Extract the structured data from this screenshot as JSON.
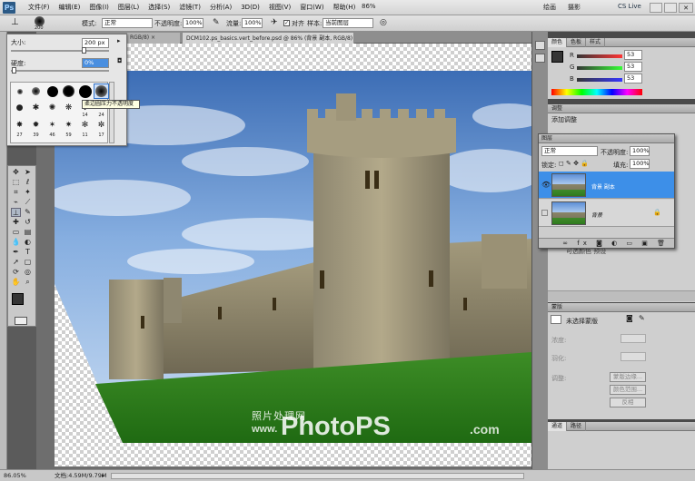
{
  "menubar": {
    "logo": "Ps",
    "items": [
      "文件(F)",
      "编辑(E)",
      "图像(I)",
      "图层(L)",
      "选择(S)",
      "滤镜(T)",
      "分析(A)",
      "3D(D)",
      "视图(V)",
      "窗口(W)",
      "帮助(H)"
    ],
    "zoom": "86%",
    "workspace": [
      "绘画",
      "摄影"
    ],
    "cslive": "CS Live"
  },
  "optionsbar": {
    "size": "200",
    "mode_label": "模式:",
    "mode_value": "正常",
    "opacity_label": "不透明度:",
    "opacity_value": "100%",
    "flow_label": "流量:",
    "flow_value": "100%",
    "align_label": "对齐",
    "sample_label": "样本:",
    "sample_value": "当前图层"
  },
  "tabs": {
    "tab1": "RGB/8) ×",
    "tab2": "DCM102.ps_basics.vert_before.psd @ 86% (背景 副本, RGB/8) *"
  },
  "brushpanel": {
    "size_label": "大小:",
    "size_value": "200 px",
    "hardness_label": "硬度:",
    "hardness_value": "0%",
    "numbers": [
      "14",
      "24",
      "27",
      "39",
      "46",
      "59",
      "11",
      "17"
    ],
    "tooltip": "柔边圆压力不透明度"
  },
  "rightpanels": {
    "color_tabs": [
      "颜色",
      "色板",
      "样式"
    ],
    "r_label": "R",
    "r_value": "53",
    "g_label": "G",
    "g_value": "53",
    "b_label": "B",
    "b_value": "53",
    "adjust_title": "调整",
    "adjust_sub": "添加调整",
    "masks_title": "蒙版",
    "masks_sub": "未选择蒙版",
    "density_label": "浓度:",
    "feather_label": "羽化:",
    "refine_label": "调整:",
    "btn_edge": "蒙版边缘...",
    "btn_color": "颜色范围...",
    "btn_invert": "反相",
    "bottom_tabs": [
      "通道",
      "路径"
    ],
    "hidden_text": "可选颜色 预设"
  },
  "layers": {
    "title": "图层",
    "blend": "正常",
    "opacity_label": "不透明度:",
    "opacity_value": "100%",
    "lock_label": "锁定:",
    "fill_label": "填充:",
    "fill_value": "100%",
    "rows": [
      {
        "name": "背景 副本"
      },
      {
        "name": "背景"
      }
    ]
  },
  "statusbar": {
    "zoom": "86.05%",
    "doc": "文档:4.59M/9.79M"
  },
  "watermark": {
    "cn": "照片处理网",
    "url1": "www.",
    "url2": "PhotoPS",
    "url3": ".com"
  }
}
